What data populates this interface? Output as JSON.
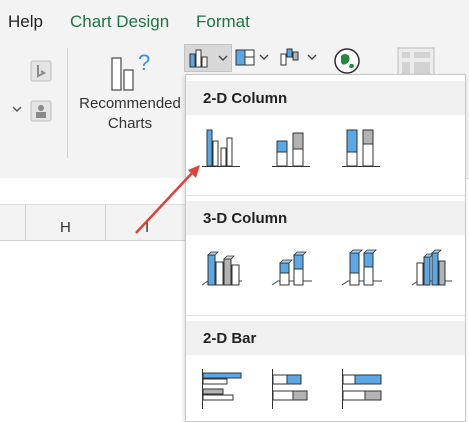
{
  "tabs": {
    "help": "Help",
    "chart_design": "Chart Design",
    "format": "Format"
  },
  "ribbon": {
    "recommended_line1": "Recommended",
    "recommended_line2": "Charts"
  },
  "columns": {
    "h": "H",
    "i": "I"
  },
  "menu": {
    "section1": "2-D Column",
    "section2": "3-D Column",
    "section3": "2-D Bar"
  },
  "colors": {
    "accent_green": "#1f7246",
    "bar_blue": "#5aa9e6",
    "bar_gray": "#b3b3b3",
    "arrow_red": "#e0413a"
  }
}
